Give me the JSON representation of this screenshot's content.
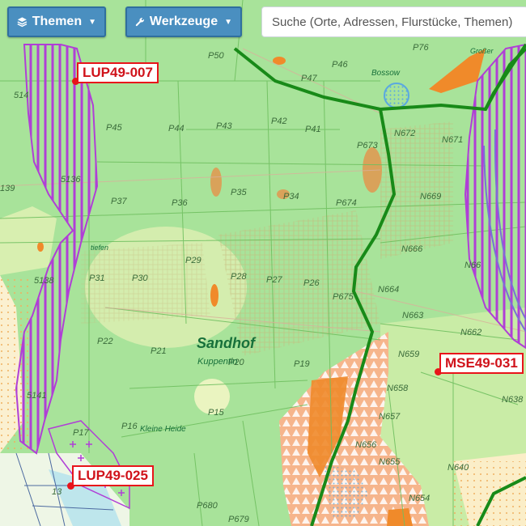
{
  "toolbar": {
    "themes_label": "Themen",
    "tools_label": "Werkzeuge"
  },
  "search": {
    "placeholder": "Suche (Orte, Adressen, Flurstücke, Themen)"
  },
  "sites": [
    {
      "id": "LUP49-007"
    },
    {
      "id": "MSE49-031"
    },
    {
      "id": "LUP49-025"
    }
  ],
  "places": {
    "sandhof": "Sandhof",
    "kuppentin": "Kuppentin",
    "bossow": "Bossow",
    "kleine_heide": "Kleine Heide",
    "grosser": "Großer",
    "tiefen": "tiefen"
  },
  "parcels": [
    "P50",
    "P46",
    "P47",
    "P45",
    "P44",
    "P43",
    "P42",
    "P41",
    "P37",
    "P36",
    "P35",
    "P34",
    "P674",
    "P673",
    "P29",
    "P30",
    "P31",
    "P28",
    "P27",
    "P26",
    "P675",
    "P22",
    "P21",
    "P20",
    "P19",
    "P15",
    "P17",
    "P16",
    "P679",
    "P680",
    "P76",
    "N672",
    "N671",
    "N669",
    "N666",
    "N664",
    "N663",
    "N662",
    "N659",
    "N658",
    "N657",
    "N656",
    "N655",
    "N654",
    "N640",
    "N638",
    "N66",
    "5138",
    "5136",
    "139",
    "5141",
    "514",
    "13"
  ],
  "colors": {
    "base_green": "#a8e39a",
    "wind_area_purple": "#b03fd6",
    "border_green": "#188a18",
    "site_red": "#e8141a",
    "toolbar_blue": "#4a8fc0"
  },
  "icons": {
    "themes": "layers-icon",
    "tools": "wrench-icon",
    "caret": "caret-down-icon"
  }
}
